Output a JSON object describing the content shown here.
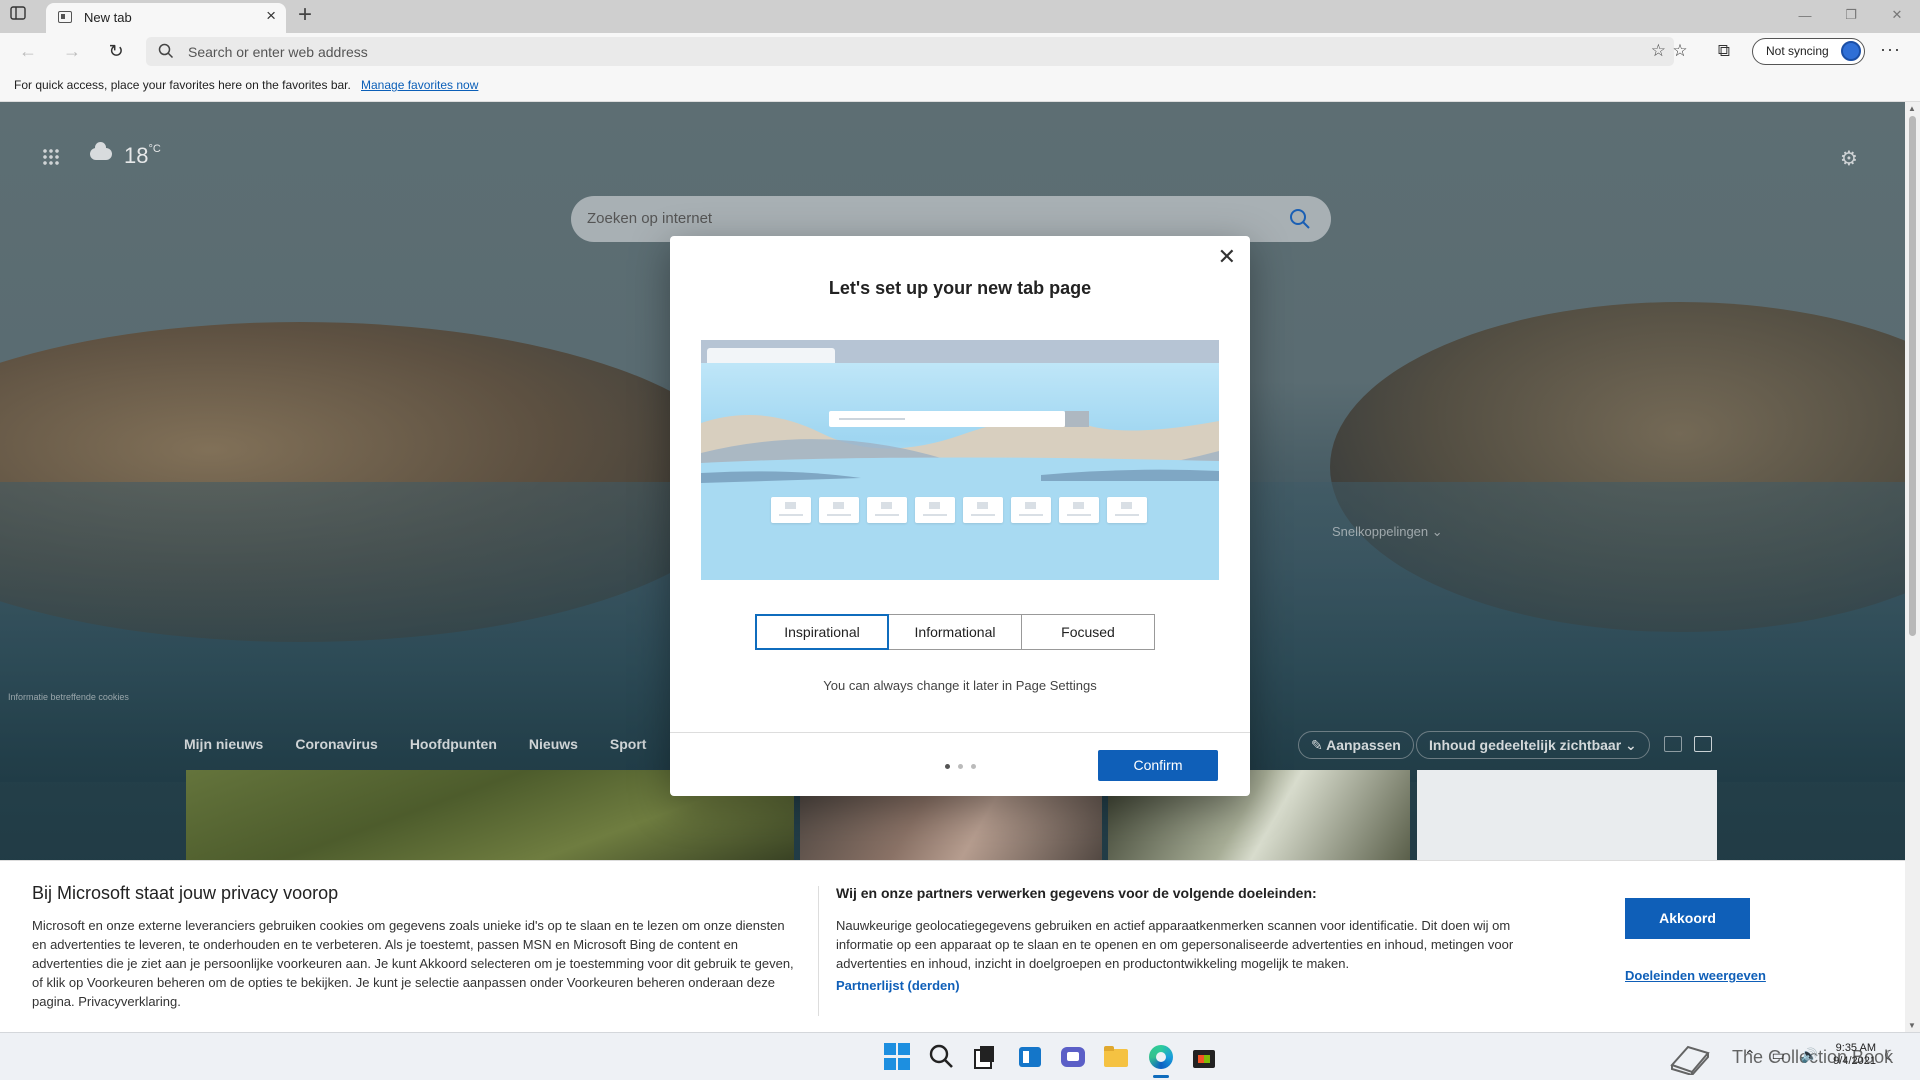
{
  "browser": {
    "tab_title": "New tab",
    "address_placeholder": "Search or enter web address",
    "sync_label": "Not syncing",
    "favorites_bar_text": "For quick access, place your favorites here on the favorites bar.",
    "favorites_bar_link": "Manage favorites now"
  },
  "newtab": {
    "temperature": "18",
    "temperature_unit": "°C",
    "search_placeholder": "Zoeken op internet",
    "shortcuts_label": "Snelkoppelingen",
    "cookie_info": "Informatie betreffende cookies",
    "feed_tabs": [
      "Mijn nieuws",
      "Coronavirus",
      "Hoofdpunten",
      "Nieuws",
      "Sport"
    ],
    "customize_label": "Aanpassen",
    "content_visibility_label": "Inhoud gedeeltelijk zichtbaar"
  },
  "modal": {
    "title": "Let's set up your new tab page",
    "layouts": [
      "Inspirational",
      "Informational",
      "Focused"
    ],
    "selected_layout": "Inspirational",
    "hint": "You can always change it later in Page Settings",
    "step": "1 of 3",
    "confirm_label": "Confirm"
  },
  "privacy": {
    "title": "Bij Microsoft staat jouw privacy voorop",
    "body": "Microsoft en onze externe leveranciers gebruiken cookies om gegevens zoals unieke id's op te slaan en te lezen om onze diensten en advertenties te leveren, te onderhouden en te verbeteren. Als je toestemt, passen MSN en Microsoft Bing de content en advertenties die je ziet aan je persoonlijke voorkeuren aan. Je kunt Akkoord selecteren om je toestemming voor dit gebruik te geven, of klik op Voorkeuren beheren om de opties te bekijken. Je kunt je selectie aanpassen onder Voorkeuren beheren onderaan deze pagina. Privacyverklaring.",
    "right_title": "Wij en onze partners verwerken gegevens voor de volgende doeleinden:",
    "right_body": "Nauwkeurige geolocatiegegevens gebruiken en actief apparaatkenmerken scannen voor identificatie. Dit doen wij om informatie op een apparaat op te slaan en te openen en om gepersonaliseerde advertenties en inhoud, metingen voor advertenties en inhoud, inzicht in doelgroepen en productontwikkeling mogelijk te maken.",
    "partners_link": "Partnerlijst (derden)",
    "accept_label": "Akkoord",
    "purposes_link": "Doeleinden weergeven"
  },
  "taskbar": {
    "time": "9:35 AM",
    "date": "9/4/2021",
    "watermark": "The Collection Book"
  },
  "colors": {
    "accent": "#0f5fb8",
    "start": "#1d8fe0"
  }
}
